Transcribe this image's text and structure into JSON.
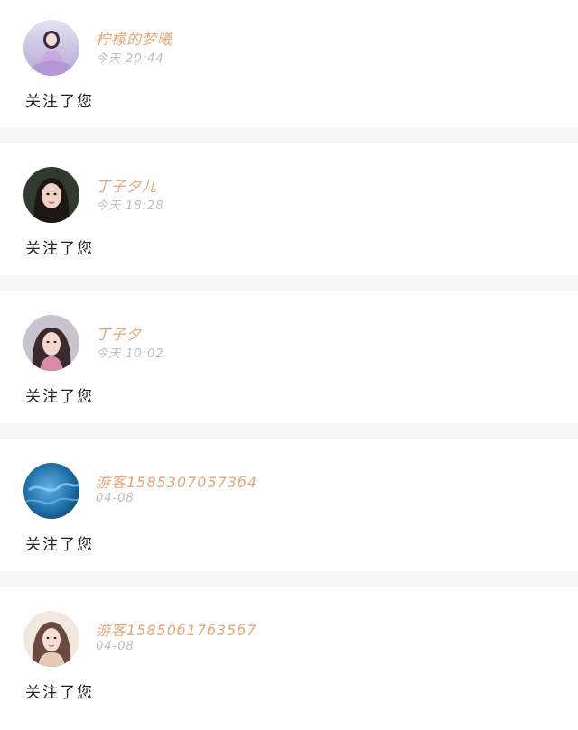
{
  "notifications": [
    {
      "name": "柠檬的梦曦",
      "time": "今天 20:44",
      "message": "关注了您",
      "avatar": "avatar-woman-lilac-costume"
    },
    {
      "name": "丁子夕儿",
      "time": "今天 18:28",
      "message": "关注了您",
      "avatar": "avatar-woman-dark-hair"
    },
    {
      "name": "丁子夕",
      "time": "今天 10:02",
      "message": "关注了您",
      "avatar": "avatar-woman-pink"
    },
    {
      "name": "游客15853070573б4",
      "time": "04-08",
      "message": "关注了您",
      "avatar": "avatar-blue-water"
    },
    {
      "name": "游客15850б17б35б7",
      "time": "04-08",
      "message": "关注了您",
      "avatar": "avatar-woman-light"
    }
  ],
  "colors": {
    "name": "#e3a77a",
    "time": "#bdbdbd",
    "message": "#222222",
    "divider": "#f6f6f6",
    "card": "#ffffff"
  }
}
